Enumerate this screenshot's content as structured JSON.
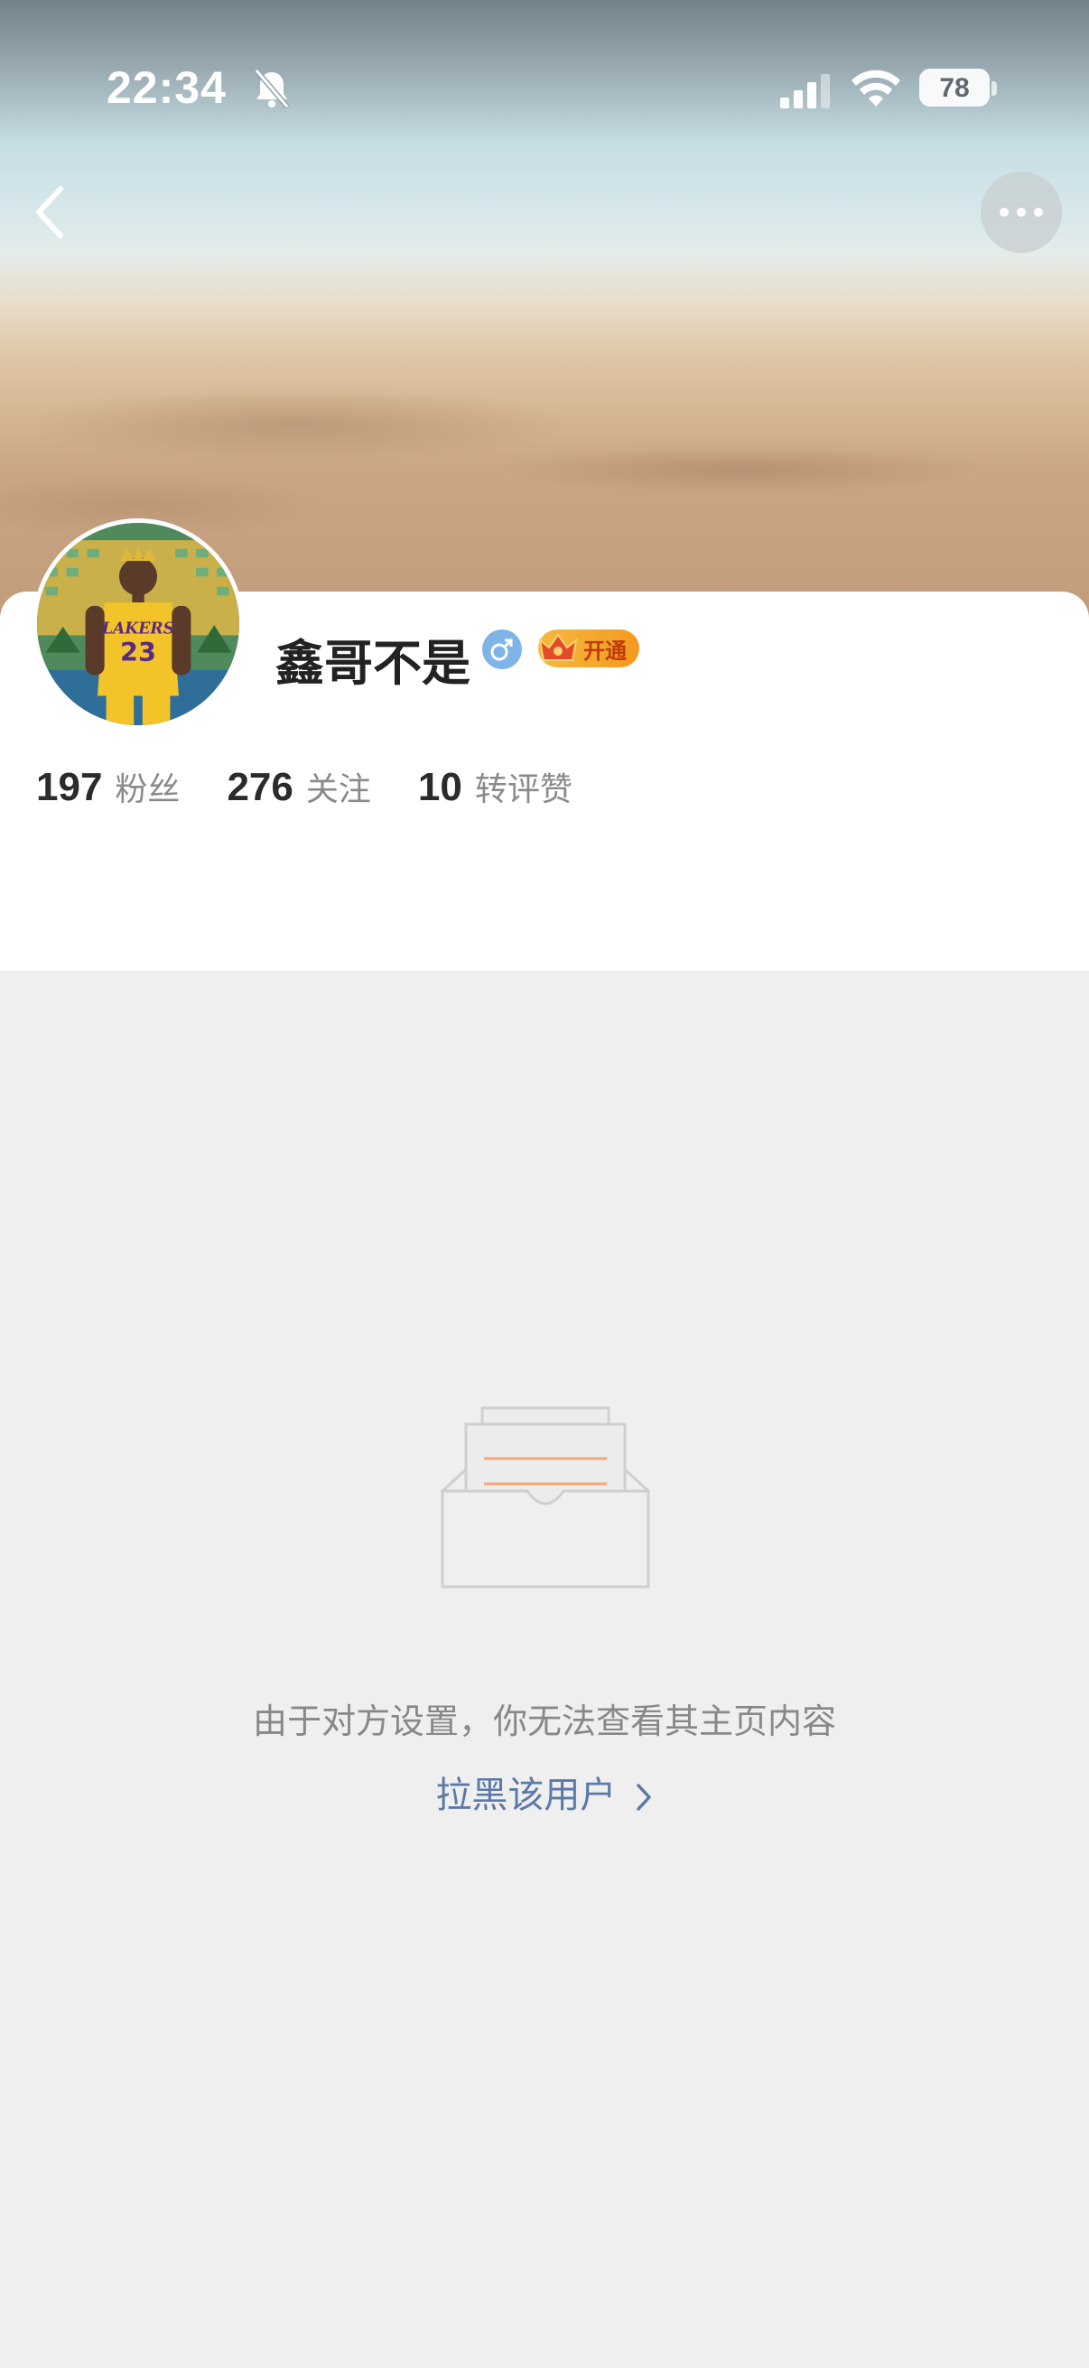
{
  "status_bar": {
    "time": "22:34",
    "battery": "78",
    "icons": [
      "mute-icon",
      "signal-icon",
      "wifi-icon",
      "battery-icon"
    ]
  },
  "nav": {
    "back_icon": "chevron-left-icon",
    "more_icon": "ellipsis-icon"
  },
  "profile": {
    "username": "鑫哥不是",
    "gender_icon": "male-icon",
    "vip_badge_label": "开通",
    "stats": [
      {
        "value": "197",
        "label": "粉丝"
      },
      {
        "value": "276",
        "label": "关注"
      },
      {
        "value": "10",
        "label": "转评赞"
      }
    ]
  },
  "empty_state": {
    "message": "由于对方设置，你无法查看其主页内容",
    "block_link": "拉黑该用户"
  },
  "colors": {
    "page_background": "#efefef",
    "link": "#5b7aa8",
    "vip_badge": "#f6b940",
    "gender_male": "#7fb4e8"
  }
}
